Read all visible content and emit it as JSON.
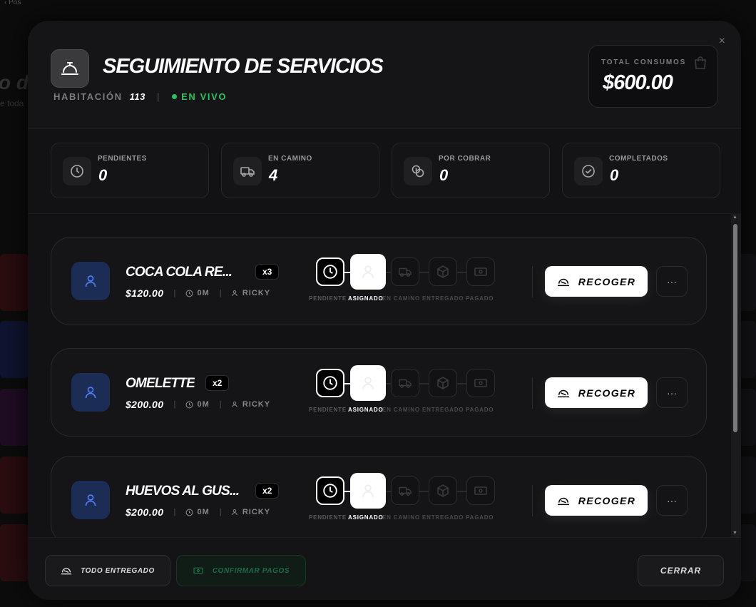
{
  "background": {
    "crumb": "‹ Pos",
    "title": "o d",
    "subtitle": "e toda"
  },
  "header": {
    "title": "SEGUIMIENTO DE SERVICIOS",
    "room_label": "HABITACIÓN",
    "room_number": "113",
    "live_label": "EN VIVO",
    "total_label": "TOTAL CONSUMOS",
    "total_value": "$600.00",
    "close_label": "×"
  },
  "stats": [
    {
      "label": "PENDIENTES",
      "value": "0",
      "icon": "clock-icon"
    },
    {
      "label": "EN CAMINO",
      "value": "4",
      "icon": "truck-icon"
    },
    {
      "label": "POR COBRAR",
      "value": "0",
      "icon": "coins-icon"
    },
    {
      "label": "COMPLETADOS",
      "value": "0",
      "icon": "check-circle-icon"
    }
  ],
  "steps": [
    "PENDIENTE",
    "ASIGNADO",
    "EN CAMINO",
    "ENTREGADO",
    "PAGADO"
  ],
  "orders": [
    {
      "name": "COCA COLA RE...",
      "qty": "x3",
      "price": "$120.00",
      "time": "0M",
      "staff": "RICKY",
      "action": "RECOGER",
      "more": "···"
    },
    {
      "name": "OMELETTE",
      "qty": "x2",
      "price": "$200.00",
      "time": "0M",
      "staff": "RICKY",
      "action": "RECOGER",
      "more": "···"
    },
    {
      "name": "HUEVOS AL GUS...",
      "qty": "x2",
      "price": "$200.00",
      "time": "0M",
      "staff": "RICKY",
      "action": "RECOGER",
      "more": "···"
    }
  ],
  "footer": {
    "delivered_label": "TODO ENTREGADO",
    "confirm_label": "CONFIRMAR PAGOS",
    "close_label": "CERRAR"
  },
  "colors": {
    "live": "#22c55e",
    "avatar_bg": "#1c2d55",
    "avatar_fg": "#4d7bf3",
    "confirm_fg": "#1f6a48"
  }
}
